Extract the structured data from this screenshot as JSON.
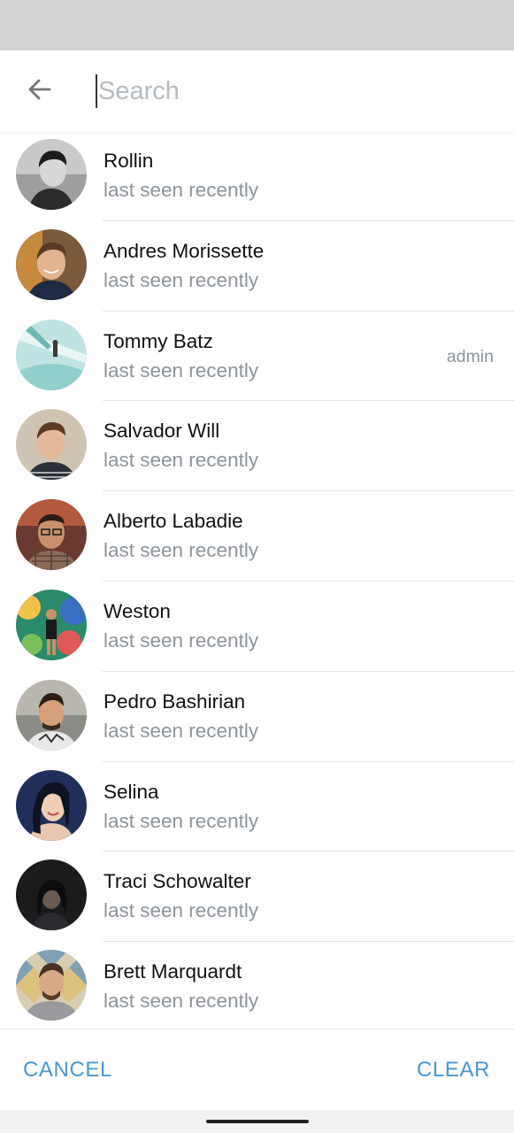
{
  "search": {
    "placeholder": "Search",
    "value": ""
  },
  "contacts": [
    {
      "name": "Rollin",
      "status": "last seen recently",
      "badge": ""
    },
    {
      "name": "Andres Morissette",
      "status": "last seen recently",
      "badge": ""
    },
    {
      "name": "Tommy Batz",
      "status": "last seen recently",
      "badge": "admin"
    },
    {
      "name": "Salvador Will",
      "status": "last seen recently",
      "badge": ""
    },
    {
      "name": "Alberto Labadie",
      "status": "last seen recently",
      "badge": ""
    },
    {
      "name": "Weston",
      "status": "last seen recently",
      "badge": ""
    },
    {
      "name": "Pedro Bashirian",
      "status": "last seen recently",
      "badge": ""
    },
    {
      "name": "Selina",
      "status": "last seen recently",
      "badge": ""
    },
    {
      "name": "Traci Schowalter",
      "status": "last seen recently",
      "badge": ""
    },
    {
      "name": "Brett Marquardt",
      "status": "last seen recently",
      "badge": ""
    }
  ],
  "actions": {
    "cancel": "CANCEL",
    "clear": "CLEAR"
  },
  "colors": {
    "accent": "#4a97cf",
    "secondary_text": "#8d949b",
    "status_bar": "#d4d4d4"
  },
  "icons": {
    "back": "arrow-left-icon"
  }
}
